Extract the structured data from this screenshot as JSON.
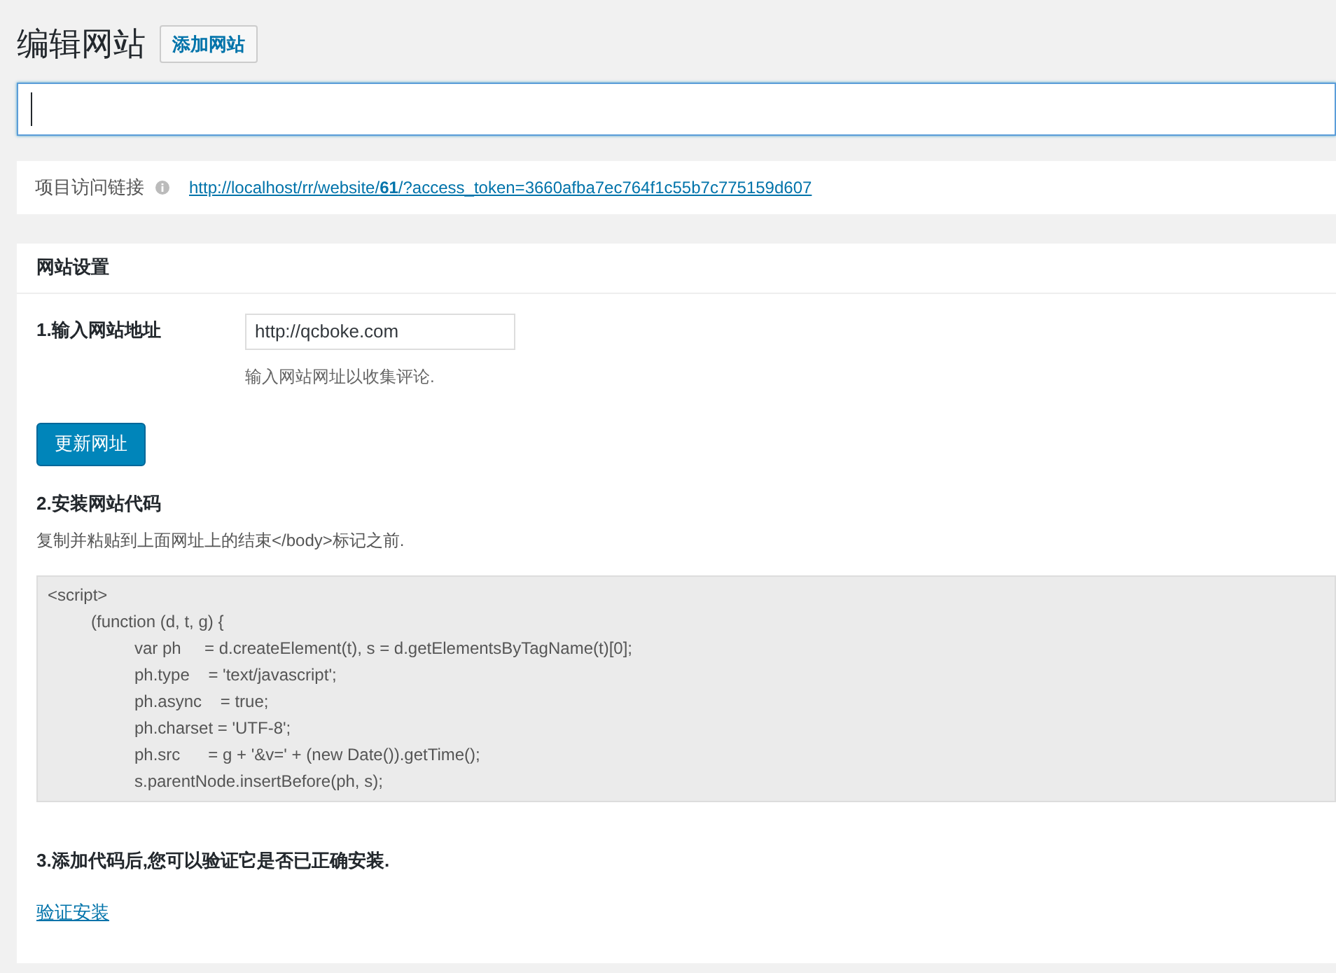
{
  "page_title": "编辑网站",
  "add_button": "添加网站",
  "title_field": {
    "focused": true
  },
  "access_link": {
    "label": "项目访问链接",
    "url": "http://localhost/rr/website/**61**/?access_token=3660afba7ec764f1c55b7c775159d607"
  },
  "settings": {
    "heading": "网站设置",
    "step1": {
      "label": "1.输入网站地址",
      "value": "http://qcboke.com",
      "hint": "输入网站网址以收集评论."
    },
    "update_button": "更新网址",
    "step2": {
      "label": "2.安装网站代码",
      "description": "复制并粘贴到上面网址上的结束</body>标记之前."
    },
    "code": [
      {
        "text": "<script>",
        "children": [
          {
            "text": "(function (d, t, g) {",
            "children": [
              {
                "text": "var ph     = d.createElement(t), s = d.getElementsByTagName(t)[0];"
              },
              {
                "text": "ph.type    = 'text/javascript';"
              },
              {
                "text": "ph.async    = true;"
              },
              {
                "text": "ph.charset = 'UTF-8';"
              },
              {
                "text": "ph.src      = g + '&v=' + (new Date()).getTime();"
              },
              {
                "text": "s.parentNode.insertBefore(ph, s);"
              }
            ]
          }
        ]
      }
    ],
    "step3": {
      "label": "3.添加代码后,您可以验证它是否已正确安装."
    },
    "verify_link": "验证安装"
  }
}
